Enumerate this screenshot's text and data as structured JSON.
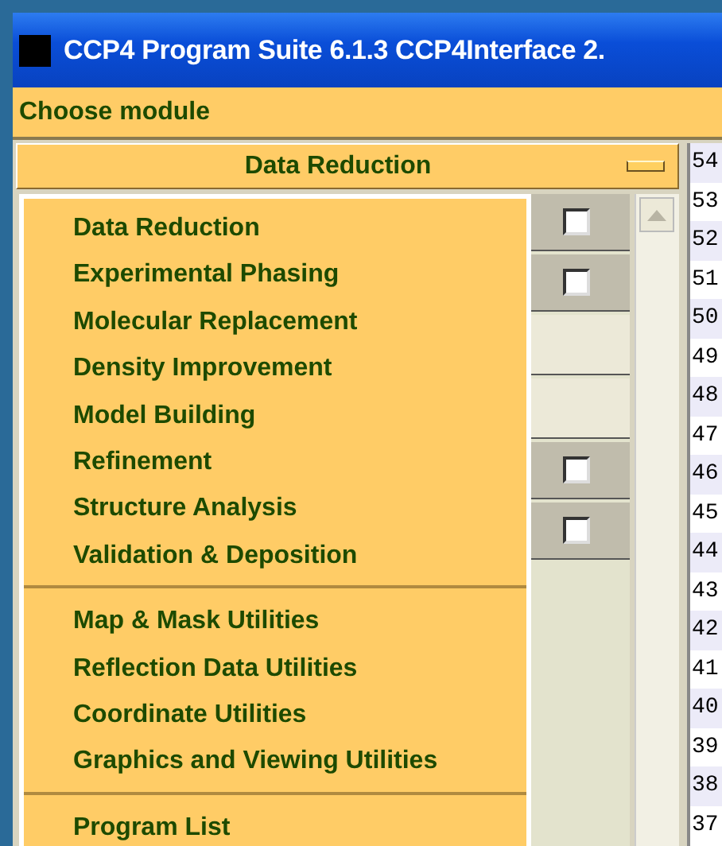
{
  "window": {
    "title": "CCP4 Program Suite 6.1.3 CCP4Interface 2."
  },
  "module_bar": {
    "label": "Choose module"
  },
  "module_selector": {
    "value": "Data Reduction"
  },
  "module_menu": {
    "groups": [
      {
        "items": [
          "Data Reduction",
          "Experimental Phasing",
          "Molecular Replacement",
          "Density Improvement",
          "Model Building",
          "Refinement",
          "Structure Analysis",
          "Validation & Deposition"
        ]
      },
      {
        "items": [
          "Map & Mask Utilities",
          "Reflection Data Utilities",
          "Coordinate Utilities",
          "Graphics and Viewing Utilities"
        ]
      },
      {
        "items": [
          "Program List"
        ]
      }
    ]
  },
  "task_rows": [
    {
      "kind": "checkbox",
      "checked": false
    },
    {
      "kind": "checkbox",
      "checked": false
    },
    {
      "kind": "blank"
    },
    {
      "kind": "blank"
    },
    {
      "kind": "checkbox",
      "checked": false
    },
    {
      "kind": "checkbox",
      "checked": false
    }
  ],
  "job_list": [
    "54",
    "53",
    "52",
    "51",
    "50",
    "49",
    "48",
    "47",
    "46",
    "45",
    "44",
    "43",
    "42",
    "41",
    "40",
    "39",
    "38",
    "37"
  ]
}
